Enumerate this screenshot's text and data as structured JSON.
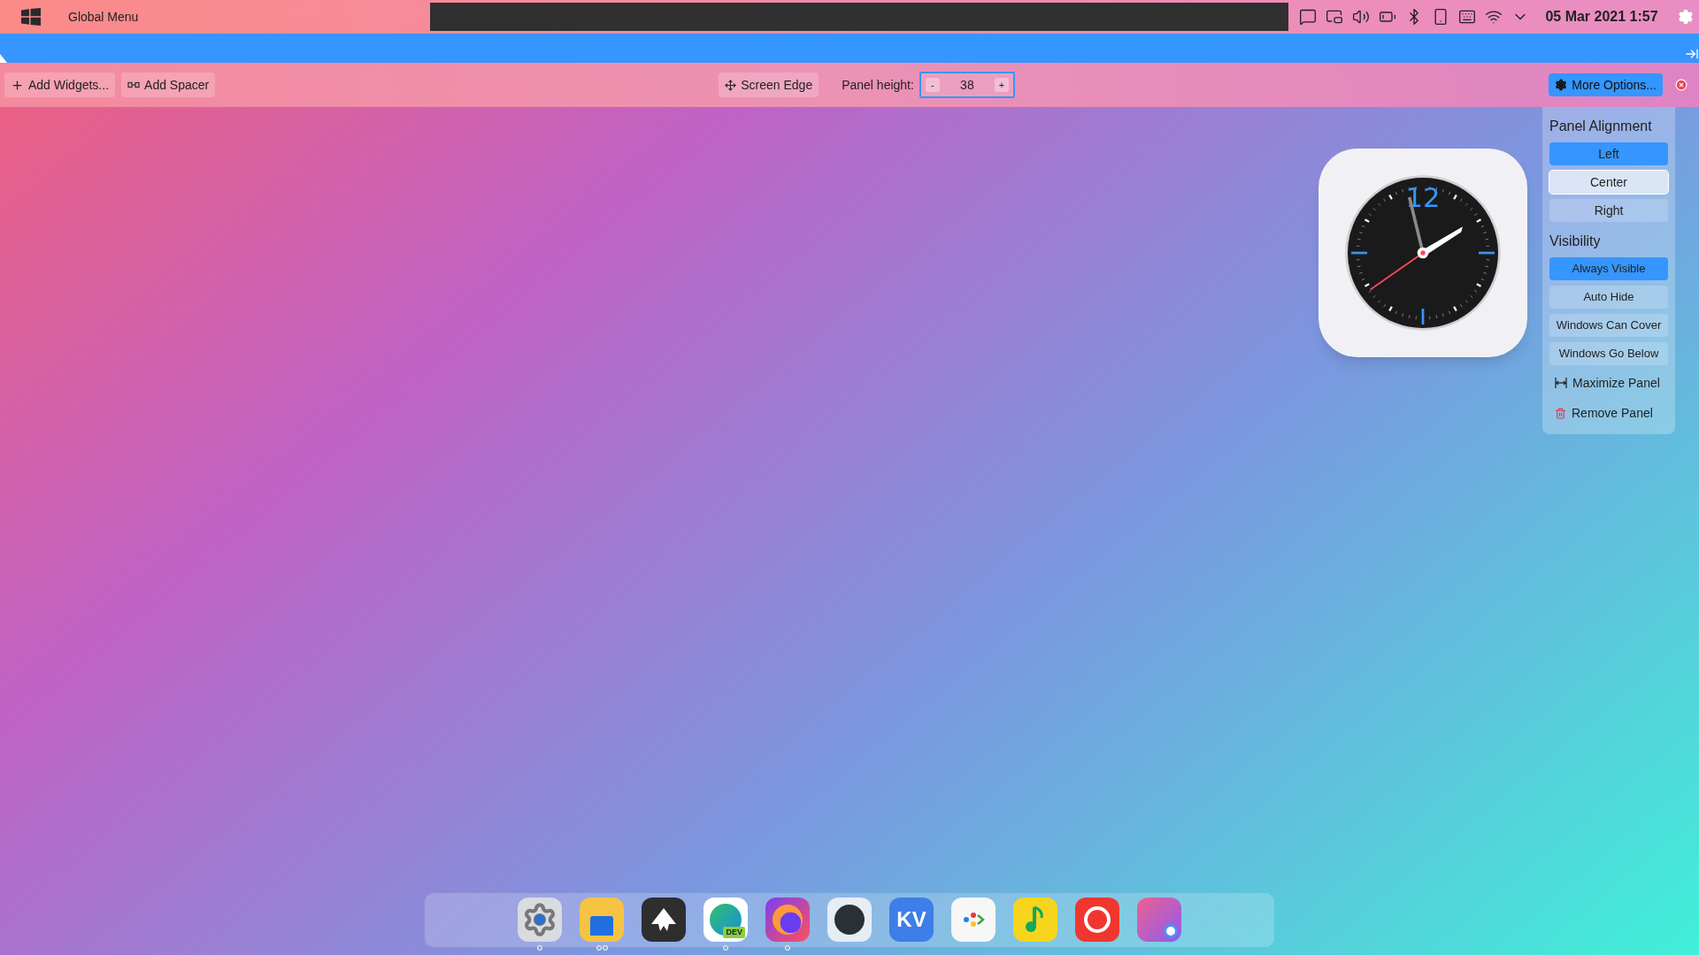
{
  "top_bar": {
    "menu_label": "Global Menu",
    "tray": [
      {
        "kind": "notes"
      },
      {
        "kind": "pip"
      },
      {
        "kind": "volume"
      },
      {
        "kind": "battery"
      },
      {
        "kind": "bluetooth"
      },
      {
        "kind": "phone"
      },
      {
        "kind": "keyboard"
      },
      {
        "kind": "network"
      },
      {
        "kind": "expand"
      }
    ],
    "clock": "05 Mar 2021 1:57"
  },
  "toolbar": {
    "left_buttons": [
      {
        "kind": "add",
        "label": "Add Widgets..."
      },
      {
        "kind": "spacer",
        "label": "Add Spacer"
      }
    ],
    "screen_edge": "Screen Edge",
    "height_label": "Panel height:",
    "height_minus": "-",
    "height_value": "38",
    "height_plus": "+",
    "more_options": "More Options..."
  },
  "clock_widget": {
    "numeral": "12"
  },
  "options_menu": {
    "alignment_title": "Panel Alignment",
    "alignment": [
      {
        "label": "Left",
        "selected": true,
        "hovered": false
      },
      {
        "label": "Center",
        "selected": false,
        "hovered": true
      },
      {
        "label": "Right",
        "selected": false,
        "hovered": false
      }
    ],
    "visibility_title": "Visibility",
    "visibility": [
      {
        "label": "Always Visible",
        "selected": true
      },
      {
        "label": "Auto Hide",
        "selected": false
      },
      {
        "label": "Windows Can Cover",
        "selected": false
      },
      {
        "label": "Windows Go Below",
        "selected": false
      }
    ],
    "actions": [
      {
        "kind": "maximize",
        "label": "Maximize Panel"
      },
      {
        "kind": "remove",
        "label": "Remove Panel"
      }
    ]
  },
  "dock": [
    {
      "kind": "settings",
      "running": true,
      "multiple": false
    },
    {
      "kind": "files",
      "running": true,
      "multiple": true
    },
    {
      "kind": "inkscape",
      "running": false
    },
    {
      "kind": "edge",
      "badge": "DEV",
      "running": true,
      "multiple": false
    },
    {
      "kind": "firefox",
      "running": true,
      "multiple": false
    },
    {
      "kind": "github",
      "running": false
    },
    {
      "kind": "kv",
      "label": "KV",
      "running": false
    },
    {
      "kind": "store",
      "running": false
    },
    {
      "kind": "music",
      "running": false
    },
    {
      "kind": "netease",
      "running": false
    },
    {
      "kind": "window",
      "running": false
    }
  ]
}
